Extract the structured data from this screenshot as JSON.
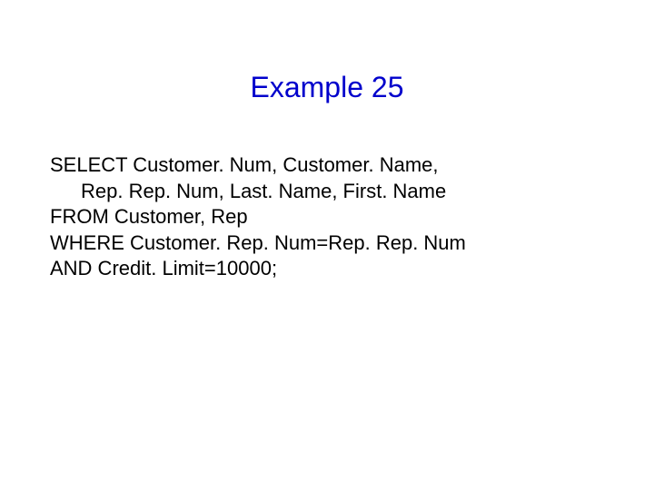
{
  "title": "Example 25",
  "sql": {
    "line1": "SELECT Customer. Num, Customer. Name,",
    "line2": "Rep. Rep. Num, Last. Name, First. Name",
    "line3": "FROM Customer, Rep",
    "line4": "WHERE Customer. Rep. Num=Rep. Rep. Num",
    "line5": "AND Credit. Limit=10000;"
  }
}
